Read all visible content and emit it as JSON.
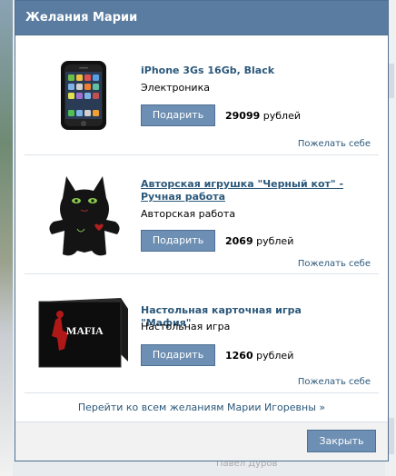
{
  "dialog": {
    "title": "Желания Марии",
    "items": [
      {
        "title": "iPhone 3Gs 16Gb, Black",
        "category": "Электроника",
        "gift_label": "Подарить",
        "price_value": "29099",
        "price_unit": " рублей",
        "wish_self_label": "Пожелать себе",
        "image_icon": "iphone-image"
      },
      {
        "title": "Авторская игрушка \"Черный кот\" - Ручная работа",
        "category": "Авторская работа",
        "gift_label": "Подарить",
        "price_value": "2069",
        "price_unit": " рублей",
        "wish_self_label": "Пожелать себе",
        "image_icon": "black-cat-toy-image"
      },
      {
        "title": "Настольная карточная игра \"Мафия\"",
        "category": "Настольная игра",
        "gift_label": "Подарить",
        "price_value": "1260",
        "price_unit": " рублей",
        "wish_self_label": "Пожелать себе",
        "image_icon": "mafia-game-box-image",
        "box_text": "MAFIA"
      }
    ],
    "all_wishes_link": "Перейти ко всем желаниям Марии Игоревны »",
    "close_label": "Закрыть"
  },
  "background": {
    "footer_text": "Павел Дуров"
  },
  "colors": {
    "header": "#5a7ca0",
    "button": "#6d8fb3",
    "link": "#2b587a"
  }
}
